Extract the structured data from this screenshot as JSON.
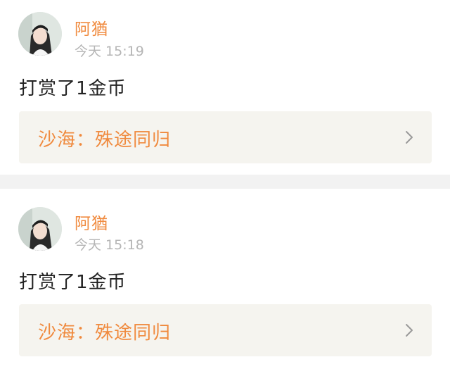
{
  "feed": {
    "items": [
      {
        "username": "阿猶",
        "time": "今天 15:19",
        "message": "打赏了1金币",
        "link_title": "沙海：殊途同归"
      },
      {
        "username": "阿猶",
        "time": "今天 15:18",
        "message": "打赏了1金币",
        "link_title": "沙海：殊途同归"
      }
    ]
  },
  "colors": {
    "accent": "#f08a3e",
    "muted_text": "#b5b5b5",
    "link_box_bg": "#f5f4ef",
    "divider": "#f2f2f2"
  },
  "icons": {
    "link_arrow": "chevron-right-icon",
    "avatar": "avatar-photo"
  }
}
